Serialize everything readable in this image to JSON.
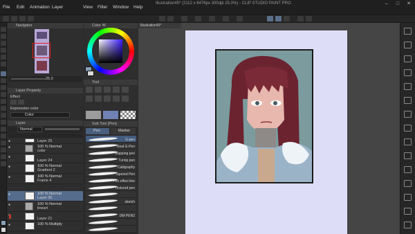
{
  "window": {
    "title": "Illustration45* (2112 x 8476px 300dpi 25.0%) - CLIP STUDIO PAINT PRO",
    "minimize": "–",
    "maximize": "□",
    "close": "✕"
  },
  "menu": [
    "File",
    "Edit",
    "Animation",
    "Layer",
    "View",
    "Filter",
    "Window",
    "Help"
  ],
  "navigator": {
    "title": "Navigator",
    "zoom": "25.0"
  },
  "color": {
    "title": "Color W"
  },
  "layer_property": {
    "title": "Layer Property",
    "effect_label": "Effect",
    "expression_label": "Expression color",
    "expression_value": "Color"
  },
  "tool_property": {
    "title": "Tool"
  },
  "sub_tool": {
    "title": "Sub Tool [Pen]",
    "tabs": [
      "Pen",
      "Marker"
    ],
    "brushes": [
      "G-pen",
      "Real G-Pen",
      "Mapping pen",
      "Turnip pen",
      "Calligraphy",
      "Tapered Pen",
      "Pen effect line",
      "Textured pen",
      "",
      "sketch",
      "",
      "DM PEN2",
      "",
      ""
    ]
  },
  "layers": {
    "title": "Layer",
    "blend_mode": "Normal",
    "rows": [
      {
        "mode": "",
        "name": "Layer 25"
      },
      {
        "mode": "100 % Normal",
        "name": "color"
      },
      {
        "mode": "",
        "name": "Layer 24"
      },
      {
        "mode": "100 % Normal",
        "name": "Gradient 2"
      },
      {
        "mode": "100 % Normal",
        "name": "Frame 4"
      },
      {
        "mode": "100 % Normal",
        "name": "Layer 30"
      },
      {
        "mode": "100 % Normal",
        "name": "lineart"
      },
      {
        "mode": "",
        "name": "Layer 21"
      },
      {
        "mode": "100 % Multiply",
        "name": ""
      }
    ]
  },
  "document_tab": "Illustration45*",
  "colors": {
    "accent": "#556c8d",
    "paper": "#ddddf7",
    "panel": "#2e2e2e"
  }
}
